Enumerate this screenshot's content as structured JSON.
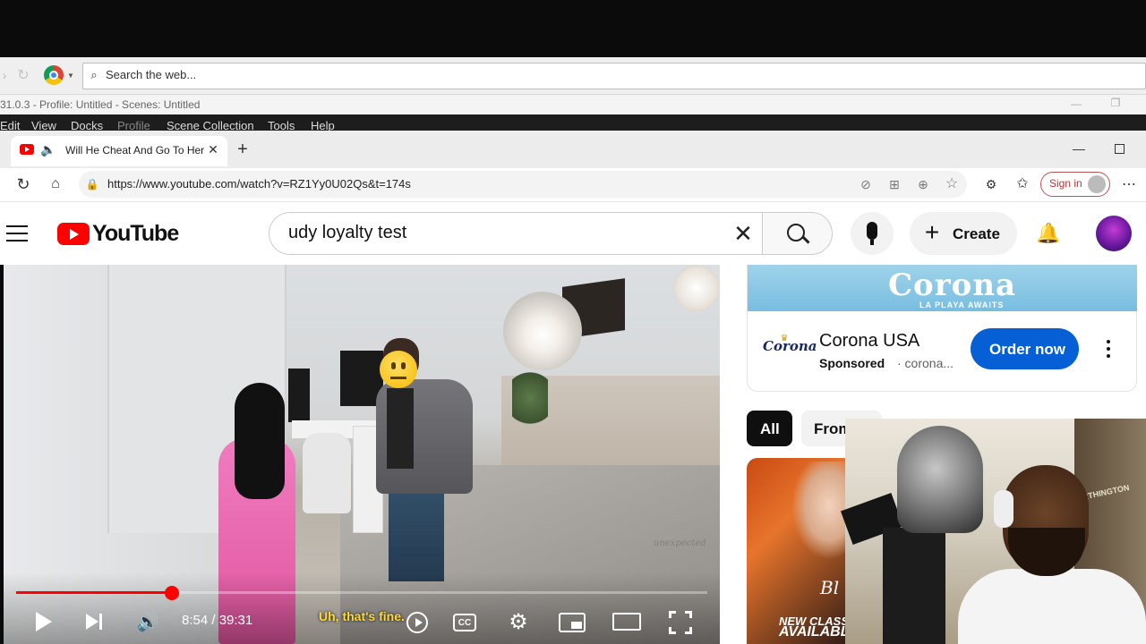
{
  "obs": {
    "search_placeholder": "Search the web...",
    "status_text": "31.0.3 - Profile: Untitled - Scenes: Untitled",
    "menu": [
      "Edit",
      "View",
      "Docks",
      "Profile",
      "Scene Collection",
      "Tools",
      "Help"
    ]
  },
  "browser": {
    "tab_title": "Will He Cheat And Go To Her",
    "url": "https://www.youtube.com/watch?v=RZ1Yy0U02Qs&t=174s",
    "sign_in_label": "Sign in"
  },
  "youtube": {
    "logo_text": "YouTube",
    "search_query": "udy loyalty test",
    "create_label": "Create"
  },
  "player": {
    "time_display": "8:54 / 39:31",
    "progress": 0.225,
    "subtitle": "Uh, that's fine.",
    "watermark": "unexpected"
  },
  "ad": {
    "banner_brand": "Corona",
    "banner_tagline": "LA PLAYA AWAITS",
    "logo_text": "Corona",
    "advertiser": "Corona USA",
    "sponsored_label": "Sponsored",
    "domain": "· corona...",
    "cta_label": "Order now"
  },
  "chips": {
    "all_label": "All",
    "from_label": "From"
  },
  "thumbnail": {
    "line1": "NEW CLASS",
    "line2": "AVAILABL",
    "brand_fragment": "Bl"
  },
  "webcam": {
    "sign_text": "ARTHINGTON"
  },
  "colors": {
    "youtube_red": "#FF0000",
    "cta_blue": "#065FD4",
    "progress_red": "#FF0000",
    "subtitle_yellow": "#FFD830"
  }
}
